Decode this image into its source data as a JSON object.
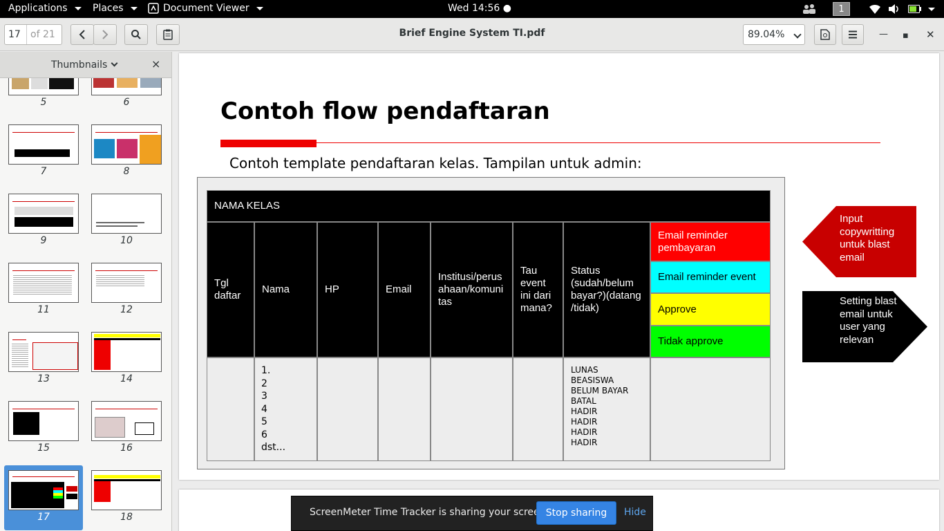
{
  "topbar": {
    "applications": "Applications",
    "places": "Places",
    "app_name": "Document Viewer",
    "clock": "Wed 14:56",
    "workspace": "1",
    "icons": [
      "people-icon",
      "wifi-icon",
      "volume-icon",
      "battery-icon",
      "caret-down-icon"
    ]
  },
  "header": {
    "current_page": "17",
    "page_total": "of 21",
    "title": "Brief Engine System TI.pdf",
    "zoom": "89.04%"
  },
  "sidebar": {
    "label": "Thumbnails",
    "close": "×",
    "pages": [
      "5",
      "6",
      "7",
      "8",
      "9",
      "10",
      "11",
      "12",
      "13",
      "14",
      "15",
      "16",
      "17",
      "18"
    ],
    "selected": "17"
  },
  "slide": {
    "title": "Contoh flow pendaftaran",
    "subtitle": "Contoh template pendaftaran kelas. Tampilan untuk admin:",
    "table": {
      "class_name": "NAMA KELAS",
      "columns": [
        "Tgl daftar",
        "Nama",
        "HP",
        "Email",
        "Institusi/perus ahaan/komuni tas",
        "Tau event ini dari mana?",
        "Status (sudah/belum bayar?)(datang /tidak)"
      ],
      "actions": [
        "Email reminder pembayaran",
        "Email reminder event",
        "Approve",
        "Tidak approve"
      ],
      "names": [
        "1.",
        "2",
        "3",
        "4",
        "5",
        "6",
        "dst..."
      ],
      "statuses": [
        "LUNAS",
        "BEASISWA",
        "BELUM BAYAR",
        "BATAL",
        "HADIR",
        "HADIR",
        "HADIR",
        "HADIR"
      ]
    },
    "callout_red": "Input copywritting untuk blast email",
    "callout_black": "Setting blast email untuk user yang relevan"
  },
  "notification": {
    "message": "ScreenMeter Time Tracker is sharing your screen.",
    "stop": "Stop sharing",
    "hide": "Hide"
  },
  "colors": {
    "accent_red": "#e00000",
    "action_red": "#ff0000",
    "action_cyan": "#00ffff",
    "action_yellow": "#ffff00",
    "action_green": "#00ff00",
    "selection_blue": "#4a90d9",
    "button_blue": "#3584e4"
  }
}
